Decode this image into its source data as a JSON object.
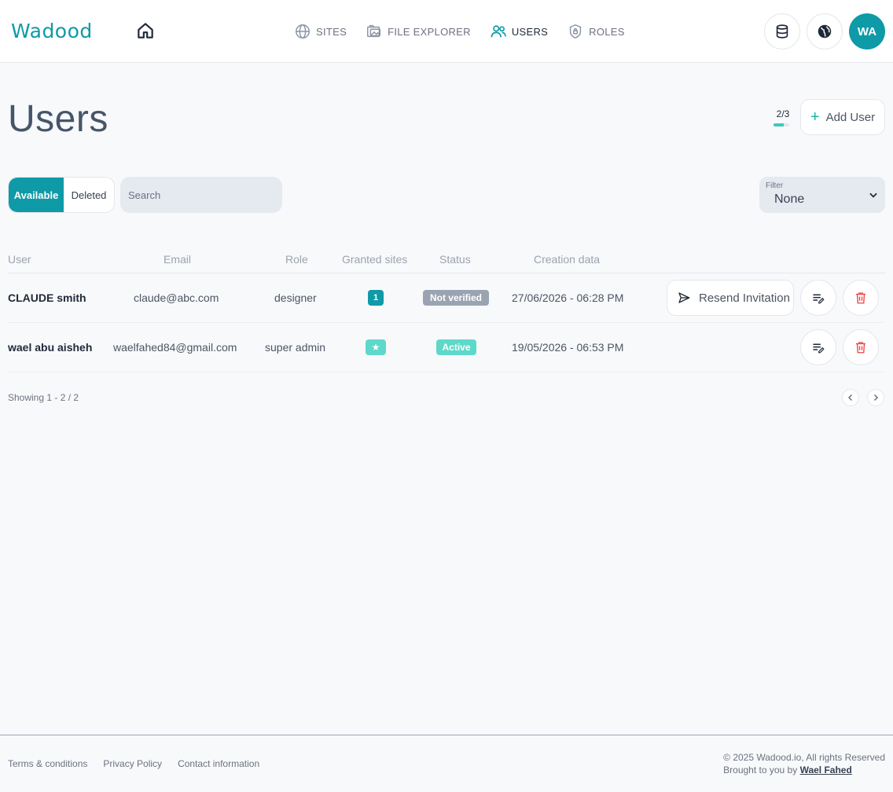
{
  "app": {
    "logo_text": "Wadood",
    "avatar_initials": "WA"
  },
  "nav": {
    "items": [
      {
        "label": "SITES",
        "icon": "globe-icon"
      },
      {
        "label": "FILE EXPLORER",
        "icon": "folder-images-icon"
      },
      {
        "label": "USERS",
        "icon": "users-icon",
        "active": true
      },
      {
        "label": "ROLES",
        "icon": "shield-lock-icon"
      }
    ]
  },
  "header_icons": [
    "database-icon",
    "globe-solid-icon",
    "home-icon"
  ],
  "page": {
    "title": "Users",
    "quota_text": "2/3",
    "quota_fraction": 0.667,
    "add_user_label": "Add User"
  },
  "toolbar": {
    "tab_available": "Available",
    "tab_deleted": "Deleted",
    "search_placeholder": "Search",
    "filter_label": "Filter",
    "filter_value": "None"
  },
  "table": {
    "columns": [
      "User",
      "Email",
      "Role",
      "Granted sites",
      "Status",
      "Creation data"
    ],
    "rows": [
      {
        "user": "CLAUDE smith",
        "email": "claude@abc.com",
        "role": "designer",
        "granted_sites": "1",
        "status": "Not verified",
        "created": "27/06/2026 - 06:28 PM",
        "resend_label": "Resend Invitation"
      },
      {
        "user": "wael abu aisheh",
        "email": "waelfahed84@gmail.com",
        "role": "super admin",
        "granted_sites": "★",
        "status": "Active",
        "created": "19/05/2026 - 06:53 PM"
      }
    ],
    "showing": "Showing 1 - 2 / 2"
  },
  "footer": {
    "links": [
      "Terms & conditions",
      "Privacy Policy",
      "Contact information"
    ],
    "copyright": "© 2025 Wadood.io, All rights Reserved",
    "brought_by": "Brought to you by",
    "author": "Wael Fahed"
  },
  "colors": {
    "brand": "#0e9aa7",
    "accent": "#5ed8c9",
    "danger": "#ef4444",
    "muted_badge": "#9aa3b1"
  }
}
